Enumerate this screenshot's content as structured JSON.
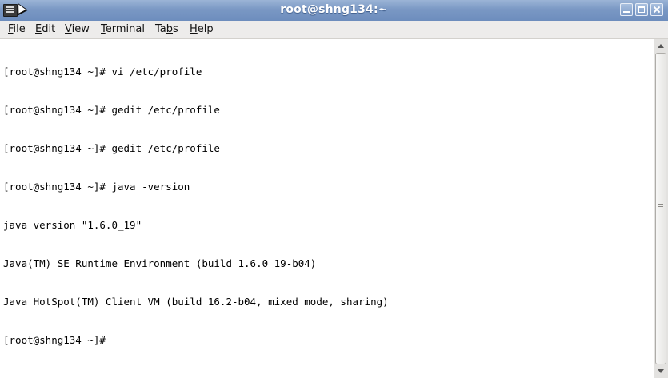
{
  "window": {
    "title": "root@shng134:~"
  },
  "menu": {
    "items": [
      {
        "label": "File"
      },
      {
        "label": "Edit"
      },
      {
        "label": "View"
      },
      {
        "label": "Terminal"
      },
      {
        "label": "Tabs"
      },
      {
        "label": "Help"
      }
    ]
  },
  "terminal": {
    "lines": [
      "[root@shng134 ~]# vi /etc/profile",
      "[root@shng134 ~]# gedit /etc/profile",
      "[root@shng134 ~]# gedit /etc/profile",
      "[root@shng134 ~]# java -version",
      "java version \"1.6.0_19\"",
      "Java(TM) SE Runtime Environment (build 1.6.0_19-b04)",
      "Java HotSpot(TM) Client VM (build 16.2-b04, mixed mode, sharing)",
      "[root@shng134 ~]#"
    ]
  },
  "icons": {
    "app": "terminal-icon",
    "minimize": "minimize-icon",
    "maximize": "maximize-icon",
    "close": "close-icon",
    "cursor": "mouse-pointer-icon"
  },
  "colors": {
    "titlebar": "#7a98c4",
    "terminal_bg": "#ffffff",
    "terminal_fg": "#000000"
  }
}
